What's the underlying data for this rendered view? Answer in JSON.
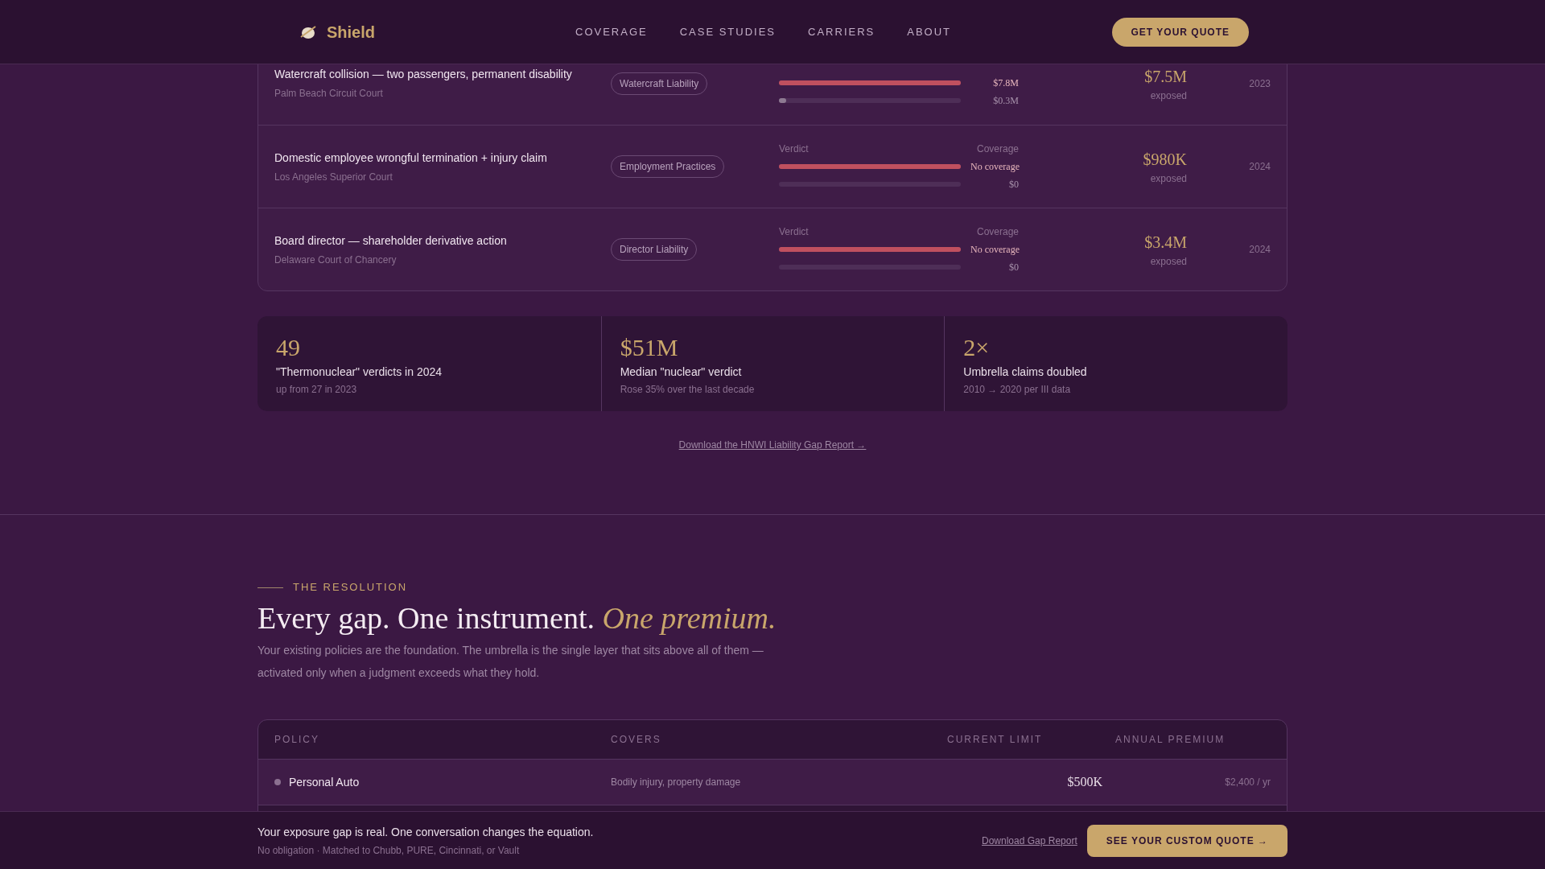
{
  "nav": {
    "brand": "Shield",
    "links": [
      {
        "label": "COVERAGE"
      },
      {
        "label": "CASE STUDIES"
      },
      {
        "label": "CARRIERS"
      },
      {
        "label": "ABOUT"
      }
    ],
    "cta": "GET YOUR QUOTE"
  },
  "cases": [
    {
      "title": "Watercraft collision — two passengers, permanent disability",
      "court": "Palm Beach Circuit Court",
      "tag": "Watercraft Liability",
      "verdict": {
        "level": 1,
        "reading": "$7.8M"
      },
      "coverage": {
        "level": 0.04,
        "reading": "$0.3M"
      },
      "amount": "$7.5M",
      "amount_note": "exposed",
      "year": "2023"
    },
    {
      "title": "Domestic employee wrongful termination + injury claim",
      "court": "Los Angeles Superior Court",
      "tag": "Employment Practices",
      "verdict_label": "Verdict",
      "coverage_label": "Coverage",
      "verdict": {
        "level": 1,
        "reading": "No coverage"
      },
      "coverage": {
        "reading": "$0"
      },
      "amount": "$980K",
      "amount_note": "exposed",
      "year": "2024"
    },
    {
      "title": "Board director — shareholder derivative action",
      "court": "Delaware Court of Chancery",
      "tag": "Director Liability",
      "verdict_label": "Verdict",
      "coverage_label": "Coverage",
      "verdict": {
        "level": 1,
        "reading": "No coverage"
      },
      "coverage": {
        "reading": "$0"
      },
      "amount": "$3.4M",
      "amount_note": "exposed",
      "year": "2024"
    }
  ],
  "stats": [
    {
      "value": "49",
      "label": "\"Thermonuclear\" verdicts in 2024",
      "note": "up from 27 in 2023"
    },
    {
      "value": "$51M",
      "label": "Median \"nuclear\" verdict",
      "note": "Rose 35% over the last decade"
    },
    {
      "value": "2×",
      "label": "Umbrella claims doubled",
      "note": "2010 → 2020 per III data"
    }
  ],
  "report_link": "Download the HNWI Liability Gap Report →",
  "resolution": {
    "eyebrow": "THE RESOLUTION",
    "heading": "Every gap. One instrument. *One premium.*",
    "body": "Your existing policies are the foundation. The umbrella is the single layer that sits above all of them — activated only when a judgment exceeds what they hold."
  },
  "policy_table": {
    "columns": [
      "POLICY",
      "COVERS",
      "CURRENT LIMIT",
      "ANNUAL PREMIUM"
    ],
    "rows": [
      {
        "policy": "Personal Auto",
        "covers": "Bodily injury, property damage",
        "limit": "$500K",
        "premium": "$2,400 / yr"
      }
    ]
  },
  "bottom_bar": {
    "title": "Your exposure gap is real. One conversation changes the equation.",
    "note": "No obligation · Matched to Chubb, PURE, Cincinnati, or Vault",
    "link": "Download Gap Report",
    "cta": "SEE YOUR CUSTOM QUOTE →"
  }
}
